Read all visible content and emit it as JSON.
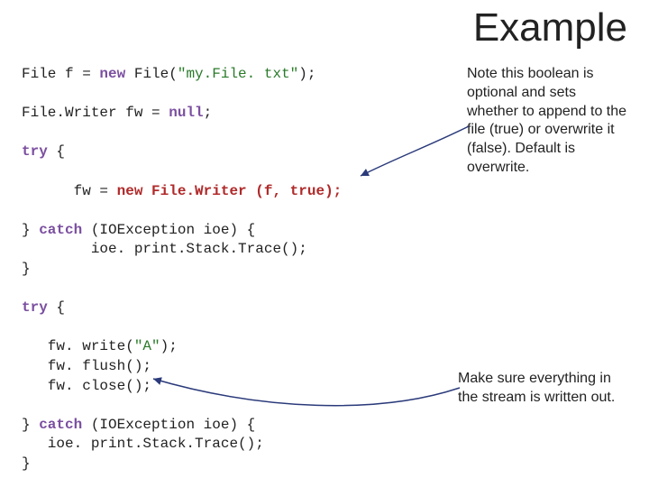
{
  "title": "Example",
  "code": {
    "l1a": "File f = ",
    "l1_kw": "new",
    "l1b": " File(",
    "l1_str": "\"my.File. txt\"",
    "l1c": ");",
    "l2a": "File.Writer fw = ",
    "l2_kw": "null",
    "l2b": ";",
    "l3_kw": "try",
    "l3a": " {",
    "l4a": "      fw = ",
    "l4_hl": "new File.Writer (f, true);",
    "l5a": "} ",
    "l5_kw1": "catch",
    "l5b": " (IOException ioe) {",
    "l6": "        ioe. print.Stack.Trace();",
    "l7": "}",
    "l8_kw": "try",
    "l8a": " {",
    "l9": "   fw. write(",
    "l9_str": "\"A\"",
    "l9b": ");",
    "l10": "   fw. flush();",
    "l11": "   fw. close();",
    "l12a": "} ",
    "l12_kw": "catch",
    "l12b": " (IOException ioe) {",
    "l13": "   ioe. print.Stack.Trace();",
    "l14": "}"
  },
  "notes": {
    "n1": "Note this boolean is optional and sets whether to append to the file (true) or overwrite it (false). Default is overwrite.",
    "n2": "Make sure everything in the stream is written out."
  }
}
